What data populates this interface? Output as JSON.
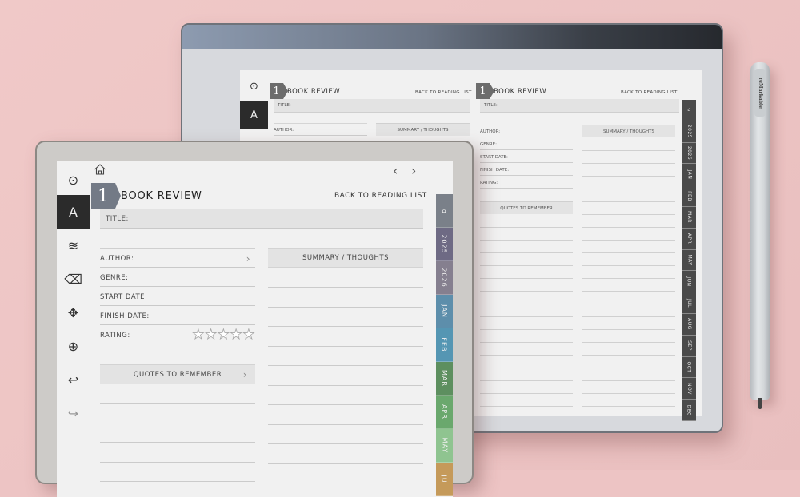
{
  "planner": {
    "page_number": "1",
    "title": "BOOK REVIEW",
    "back_link": "BACK TO READING LIST",
    "fields": {
      "title": "TITLE:",
      "author": "AUTHOR:",
      "genre": "GENRE:",
      "start_date": "START DATE:",
      "finish_date": "FINISH DATE:",
      "rating": "RATING:"
    },
    "rating": {
      "value": 0,
      "max": 5,
      "star_glyph": "☆"
    },
    "chevron": "›",
    "summary_header": "SUMMARY / THOUGHTS",
    "quotes_header": "QUOTES TO REMEMBER"
  },
  "front_device": {
    "nav": {
      "prev": "‹",
      "next": "›"
    },
    "toolbar": [
      {
        "name": "selector-circle-icon",
        "glyph": "⊙"
      },
      {
        "name": "pen-tool-icon",
        "glyph": "A",
        "active": true
      },
      {
        "name": "pencil-strokes-icon",
        "glyph": "≋"
      },
      {
        "name": "eraser-icon",
        "glyph": "⌫"
      },
      {
        "name": "move-icon",
        "glyph": "✥"
      },
      {
        "name": "zoom-in-icon",
        "glyph": "⊕"
      },
      {
        "name": "undo-icon",
        "glyph": "↩"
      },
      {
        "name": "redo-icon",
        "glyph": "↪",
        "faded": true
      }
    ],
    "side_tabs": [
      {
        "label": "⌂",
        "color": "#7a8089"
      },
      {
        "label": "2025",
        "color": "#6e6a84"
      },
      {
        "label": "2026",
        "color": "#857f8f"
      },
      {
        "label": "JAN",
        "color": "#5d8eab"
      },
      {
        "label": "FEB",
        "color": "#5596b3"
      },
      {
        "label": "MAR",
        "color": "#5d8f5f"
      },
      {
        "label": "APR",
        "color": "#6aa86d"
      },
      {
        "label": "MAY",
        "color": "#8fc490"
      },
      {
        "label": "JU",
        "color": "#c59a5a"
      }
    ]
  },
  "back_device": {
    "toolbar": [
      {
        "name": "selector-circle-icon",
        "glyph": "⊙"
      },
      {
        "name": "pen-tool-icon",
        "glyph": "A",
        "active": true
      }
    ],
    "side_tabs": [
      "⌂",
      "2025",
      "2026",
      "JAN",
      "FEB",
      "MAR",
      "APR",
      "MAY",
      "JUN",
      "JUL",
      "AUG",
      "SEP",
      "OCT",
      "NOV",
      "DEC"
    ]
  },
  "stylus": {
    "brand": "reMarkable"
  }
}
